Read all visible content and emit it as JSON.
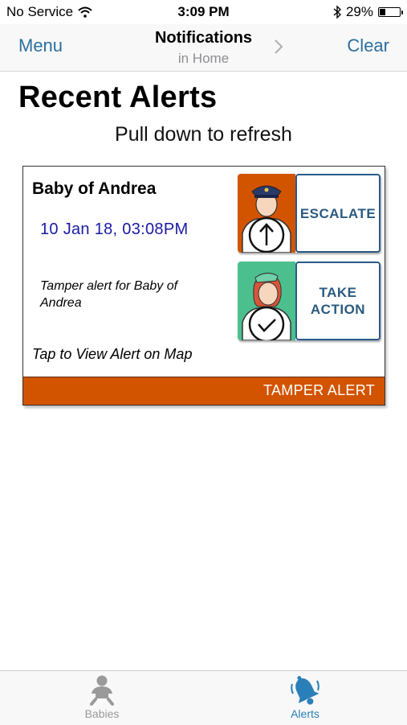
{
  "status_bar": {
    "carrier": "No Service",
    "time": "3:09 PM",
    "battery_percent": "29%",
    "battery_level": 0.29,
    "icons": [
      "wifi-icon",
      "bluetooth-icon",
      "battery-icon"
    ]
  },
  "nav": {
    "left_label": "Menu",
    "title": "Notifications",
    "subtitle": "in Home",
    "right_label": "Clear"
  },
  "page": {
    "title": "Recent Alerts",
    "refresh_hint": "Pull down to refresh"
  },
  "alert": {
    "name": "Baby of Andrea",
    "timestamp": "10 Jan 18, 03:08PM",
    "description": "Tamper alert for Baby of Andrea",
    "map_link": "Tap to View Alert on Map",
    "type_label": "TAMPER ALERT",
    "actions": {
      "escalate_label": "ESCALATE",
      "take_action_line1": "TAKE",
      "take_action_line2": "ACTION"
    }
  },
  "tabs": {
    "babies_label": "Babies",
    "alerts_label": "Alerts"
  },
  "colors": {
    "accent_blue": "#2b6f9e",
    "timestamp_blue": "#1a1aa6",
    "alert_orange": "#d35400",
    "action_green": "#4cbf8f",
    "tab_inactive": "#9a9a9a"
  }
}
